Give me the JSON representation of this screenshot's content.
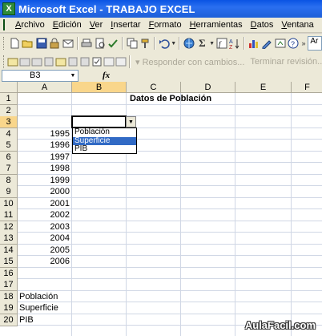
{
  "window": {
    "title": "Microsoft Excel - TRABAJO EXCEL",
    "app_icon": "X"
  },
  "menu": [
    "Archivo",
    "Edición",
    "Ver",
    "Insertar",
    "Formato",
    "Herramientas",
    "Datos",
    "Ventana",
    "?"
  ],
  "toolbar2": {
    "reply_changes": "Responder con cambios...",
    "end_review": "Terminar revisión..."
  },
  "toolbar1": {
    "font_name_partial": "Ar"
  },
  "formula_bar": {
    "name_box": "B3",
    "fx_label": "fx",
    "formula": ""
  },
  "columns": [
    "A",
    "B",
    "C",
    "D",
    "E",
    "F"
  ],
  "rows": [
    "1",
    "2",
    "3",
    "4",
    "5",
    "6",
    "7",
    "8",
    "9",
    "10",
    "11",
    "12",
    "13",
    "14",
    "15",
    "16",
    "17",
    "18",
    "19",
    "20"
  ],
  "cells": {
    "C1": "Datos de Población",
    "A4": "1995",
    "A5": "1996",
    "A6": "1997",
    "A7": "1998",
    "A8": "1999",
    "A9": "2000",
    "A10": "2001",
    "A11": "2002",
    "A12": "2003",
    "A13": "2004",
    "A14": "2005",
    "A15": "2006",
    "A18": "Población",
    "A19": "Superficie",
    "A20": "PIB"
  },
  "active_cell": "B3",
  "dropdown": {
    "options": [
      "Población",
      "Superficie",
      "PIB"
    ],
    "highlighted": "Superficie"
  },
  "watermark": "AulaFacil.com"
}
